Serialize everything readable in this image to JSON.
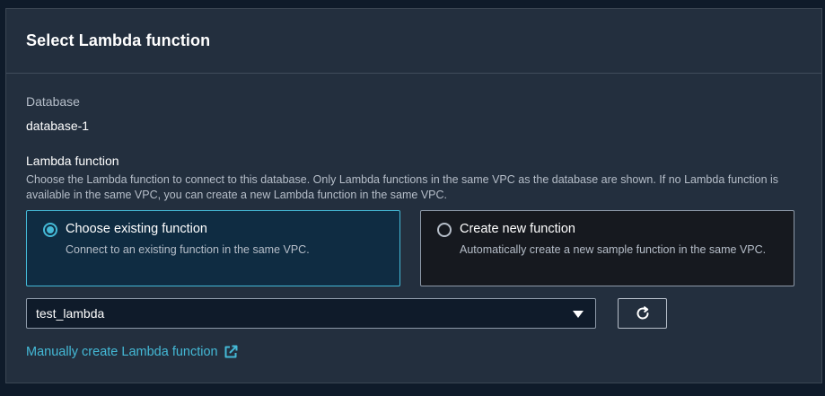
{
  "panel": {
    "title": "Select Lambda function"
  },
  "database": {
    "label": "Database",
    "value": "database-1"
  },
  "lambda_function": {
    "label": "Lambda function",
    "description": "Choose the Lambda function to connect to this database. Only Lambda functions in the same VPC as the database are shown. If no Lambda function is available in the same VPC, you can create a new Lambda function in the same VPC."
  },
  "options": [
    {
      "title": "Choose existing function",
      "description": "Connect to an existing function in the same VPC.",
      "selected": true
    },
    {
      "title": "Create new function",
      "description": "Automatically create a new sample function in the same VPC.",
      "selected": false
    }
  ],
  "select": {
    "value": "test_lambda",
    "icon": "caret-down-icon"
  },
  "refresh": {
    "icon": "refresh-icon"
  },
  "manual_link": {
    "label": "Manually create Lambda function",
    "icon": "external-link-icon"
  },
  "colors": {
    "accent": "#44b9d6",
    "panel_bg": "#232f3e",
    "page_bg": "#0f1b2a"
  }
}
